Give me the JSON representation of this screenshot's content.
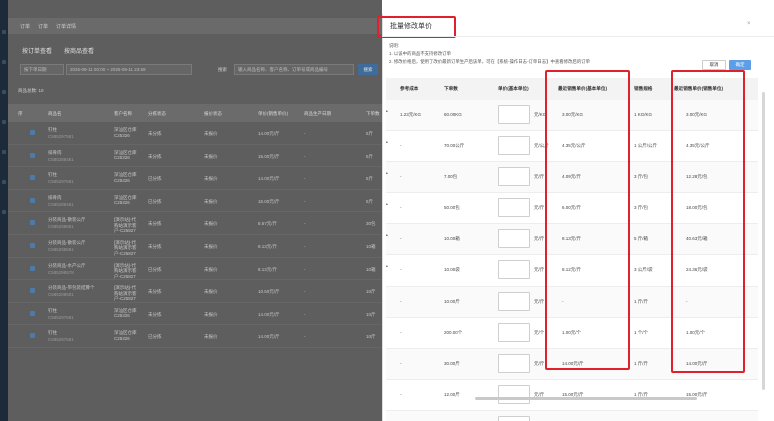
{
  "app": {
    "topbar": [
      "订单",
      "订单",
      "订单详情"
    ],
    "tabs": [
      "按订单查看",
      "按商品查看"
    ],
    "filters": {
      "date_type": "按下单日期",
      "date_range": "2025-09-11 00:00 ~ 2025-09-11 23:59",
      "search_label": "搜索",
      "search_placeholder": "输入商品名称、客户名称、订单号或商品编号",
      "search_button": "搜索"
    },
    "count_label": "商品总数: 10",
    "headers": [
      "序",
      "商品名",
      "客户名称",
      "分拣状态",
      "报价状态",
      "单价(销售单价)",
      "商品生产日期",
      "下单数"
    ],
    "rows": [
      {
        "name": "钉柱",
        "code": "C585297581",
        "customer": "深汕区仓库\nC25326",
        "sort": "未分拣",
        "quote": "未报价",
        "price": "14.00元/斤",
        "qty": "5斤"
      },
      {
        "name": "排骨肉",
        "code": "C585288461",
        "customer": "深汕区仓库\nC25326",
        "sort": "未分拣",
        "quote": "未报价",
        "price": "15.00元/斤",
        "qty": "5斤"
      },
      {
        "name": "钉柱",
        "code": "C585297581",
        "customer": "深汕区仓库\nC25326",
        "sort": "已分拣",
        "quote": "未报价",
        "price": "14.00元/斤",
        "qty": "5斤"
      },
      {
        "name": "排骨肉",
        "code": "C585288461",
        "customer": "深汕区仓库\nC25326",
        "sort": "已分拣",
        "quote": "未报价",
        "price": "15.00元/斤",
        "qty": "5斤"
      },
      {
        "name": "分装商品-散装公斤",
        "code": "C585298581",
        "customer": "[演示站]-代\n购站演示客\n户-C25827",
        "sort": "未分拣",
        "quote": "未报价",
        "price": "8.67元/斤",
        "qty": "30包"
      },
      {
        "name": "分装商品-散装公斤",
        "code": "C585298581",
        "customer": "[演示站]-代\n购站演示客\n户-C25827",
        "sort": "未分拣",
        "quote": "未报价",
        "price": "8.13元/斤",
        "qty": "10箱"
      },
      {
        "name": "分装商品-水产公斤",
        "code": "C585298578",
        "customer": "[演示站]-代\n购站演示客\n户-C25827",
        "sort": "已分拣",
        "quote": "未报价",
        "price": "8.13元/斤",
        "qty": "10箱"
      },
      {
        "name": "分装商品-带包装结算个",
        "code": "C585288591",
        "customer": "[演示站]-代\n购站演示客\n户-C25827",
        "sort": "未分拣",
        "quote": "未报价",
        "price": "10.50元/斤",
        "qty": "10斤"
      },
      {
        "name": "钉柱",
        "code": "C585297581",
        "customer": "深汕区仓库\nC25326",
        "sort": "未分拣",
        "quote": "未报价",
        "price": "14.00元/斤",
        "qty": "10斤"
      },
      {
        "name": "钉柱",
        "code": "C585297581",
        "customer": "深汕区仓库\nC25326",
        "sort": "已分拣",
        "quote": "未报价",
        "price": "14.00元/斤",
        "qty": "10斤"
      }
    ]
  },
  "modal": {
    "title": "批量修改单价",
    "close": "×",
    "note_title": "说明:",
    "note_1": "1. 以该中的商品不支持修改订单",
    "note_2": "2. 修改价格后，使用了改价最新订单生产后该单，可在【系统-操作日志-订单日志】中查看修改后的订单",
    "cancel_label": "取消",
    "confirm_label": "确定",
    "headers": [
      "参考成本",
      "下单数",
      "单价(基本单位)",
      "最近销售单价(基本单位)",
      "销售规格",
      "最近销售单价(销售单位)"
    ],
    "rows": [
      {
        "cost": "1.23元/KG",
        "qty": "60.00KG",
        "unit": "元/KG",
        "recent_base": "3.00元/KG",
        "spec": "1 KG/KG",
        "recent_sale": "3.00元/KG"
      },
      {
        "cost": "-",
        "qty": "70.00公斤",
        "unit": "元/公斤",
        "recent_base": "4.35元/公斤",
        "spec": "1 公斤/公斤",
        "recent_sale": "4.35元/公斤"
      },
      {
        "cost": "-",
        "qty": "7.00包",
        "unit": "元/斤",
        "recent_base": "4.09元/斤",
        "spec": "3 斤/包",
        "recent_sale": "12.28元/包"
      },
      {
        "cost": "-",
        "qty": "50.00包",
        "unit": "元/斤",
        "recent_base": "6.00元/斤",
        "spec": "3 斤/包",
        "recent_sale": "18.00元/包"
      },
      {
        "cost": "-",
        "qty": "10.00箱",
        "unit": "元/斤",
        "recent_base": "8.13元/斤",
        "spec": "5 斤/箱",
        "recent_sale": "40.63元/箱"
      },
      {
        "cost": "-",
        "qty": "10.00袋",
        "unit": "元/斤",
        "recent_base": "8.12元/斤",
        "spec": "3 公斤/袋",
        "recent_sale": "24.36元/袋"
      },
      {
        "cost": "-",
        "qty": "10.00斤",
        "unit": "元/斤",
        "recent_base": "-",
        "spec": "1 斤/斤",
        "recent_sale": "-"
      },
      {
        "cost": "-",
        "qty": "200.00个",
        "unit": "元/个",
        "recent_base": "1.00元/个",
        "spec": "1 个/个",
        "recent_sale": "1.00元/个"
      },
      {
        "cost": "-",
        "qty": "30.00斤",
        "unit": "元/斤",
        "recent_base": "14.00元/斤",
        "spec": "1 斤/斤",
        "recent_sale": "14.00元/斤"
      },
      {
        "cost": "-",
        "qty": "12.00斤",
        "unit": "元/斤",
        "recent_base": "15.00元/斤",
        "spec": "1 斤/斤",
        "recent_sale": "15.00元/斤"
      },
      {
        "cost": "-",
        "qty": "4.00斤",
        "unit": "元/斤",
        "recent_base": "-",
        "spec": "1 斤/斤",
        "recent_sale": "-"
      }
    ]
  },
  "colors": {
    "highlight": "#e0202a",
    "primary": "#5c9ee8"
  }
}
